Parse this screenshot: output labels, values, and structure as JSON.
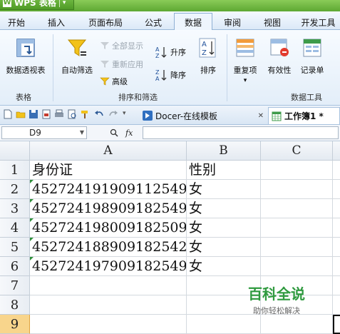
{
  "app": {
    "title": "WPS 表格",
    "menu_arrow": "▾"
  },
  "tabs": [
    {
      "label": "开始"
    },
    {
      "label": "插入"
    },
    {
      "label": "页面布局"
    },
    {
      "label": "公式"
    },
    {
      "label": "数据"
    },
    {
      "label": "审阅"
    },
    {
      "label": "视图"
    },
    {
      "label": "开发工具"
    }
  ],
  "active_tab": "数据",
  "ribbon": {
    "pivot_label": "数据透视表",
    "autofilter_label": "自动筛选",
    "show_all_label": "全部显示",
    "reapply_label": "重新应用",
    "advanced_label": "高级",
    "sort_asc_label": "升序",
    "sort_desc_label": "降序",
    "sort_label": "排序",
    "duplicates_label": "重复项",
    "validity_label": "有效性",
    "record_label": "记录单",
    "group_table": "表格",
    "group_sort_filter": "排序和筛选",
    "group_data_tools": "数据工具"
  },
  "doc_tabs": [
    {
      "label": "Docer-在线模板",
      "close": "✕"
    },
    {
      "label": "工作簿1 *"
    }
  ],
  "formula_bar": {
    "name_box": "D9",
    "fx": "fx",
    "formula": ""
  },
  "sheet": {
    "columns": [
      "A",
      "B",
      "C"
    ],
    "rows": [
      {
        "num": "1",
        "a": "身份证",
        "b": "性别"
      },
      {
        "num": "2",
        "a": "452724191909112549",
        "b": "女"
      },
      {
        "num": "3",
        "a": "452724198909182549",
        "b": "女"
      },
      {
        "num": "4",
        "a": "452724198009182509",
        "b": "女"
      },
      {
        "num": "5",
        "a": "452724188909182542",
        "b": "女"
      },
      {
        "num": "6",
        "a": "452724197909182549",
        "b": "女"
      },
      {
        "num": "7",
        "a": "",
        "b": ""
      },
      {
        "num": "8",
        "a": "",
        "b": ""
      },
      {
        "num": "9",
        "a": "",
        "b": ""
      }
    ],
    "selected_row": "9",
    "selected_cell": "D9"
  },
  "watermark": {
    "title": "百科全说",
    "subtitle": "助你轻松解决"
  },
  "colors": {
    "title_green": "#5da832",
    "selected_row_header": "#f8d58c",
    "ribbon_bg": "#e3eef9",
    "watermark_green": "#2f9a3f"
  }
}
